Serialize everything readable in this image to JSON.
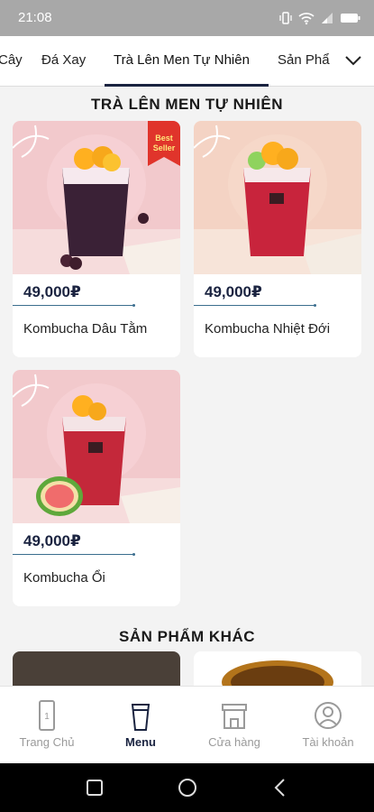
{
  "status_bar": {
    "time": "21:08"
  },
  "tabs": [
    {
      "label": "Cây"
    },
    {
      "label": "Đá Xay"
    },
    {
      "label": "Trà Lên Men Tự Nhiên"
    },
    {
      "label": "Sản Phẩ"
    }
  ],
  "active_tab_index": 2,
  "section": {
    "title": "TRÀ LÊN MEN TỰ NHIÊN",
    "products": [
      {
        "price": "49,000₽",
        "name": "Kombucha Dâu Tằm",
        "badge": "Best Seller",
        "badge_top": "Best",
        "badge_bottom": "Seller"
      },
      {
        "price": "49,000₽",
        "name": "Kombucha Nhiệt Đới"
      },
      {
        "price": "49,000₽",
        "name": "Kombucha Ổi"
      }
    ]
  },
  "other": {
    "title": "SẢN PHẨM KHÁC"
  },
  "bottom_nav": [
    {
      "label": "Trang Chủ",
      "icon": "phone-icon"
    },
    {
      "label": "Menu",
      "icon": "cup-icon"
    },
    {
      "label": "Cửa hàng",
      "icon": "store-icon"
    },
    {
      "label": "Tài khoản",
      "icon": "user-icon"
    }
  ],
  "active_nav_index": 1,
  "colors": {
    "accent": "#1a2340",
    "price": "#1a2340",
    "badge": "#e0342b"
  }
}
